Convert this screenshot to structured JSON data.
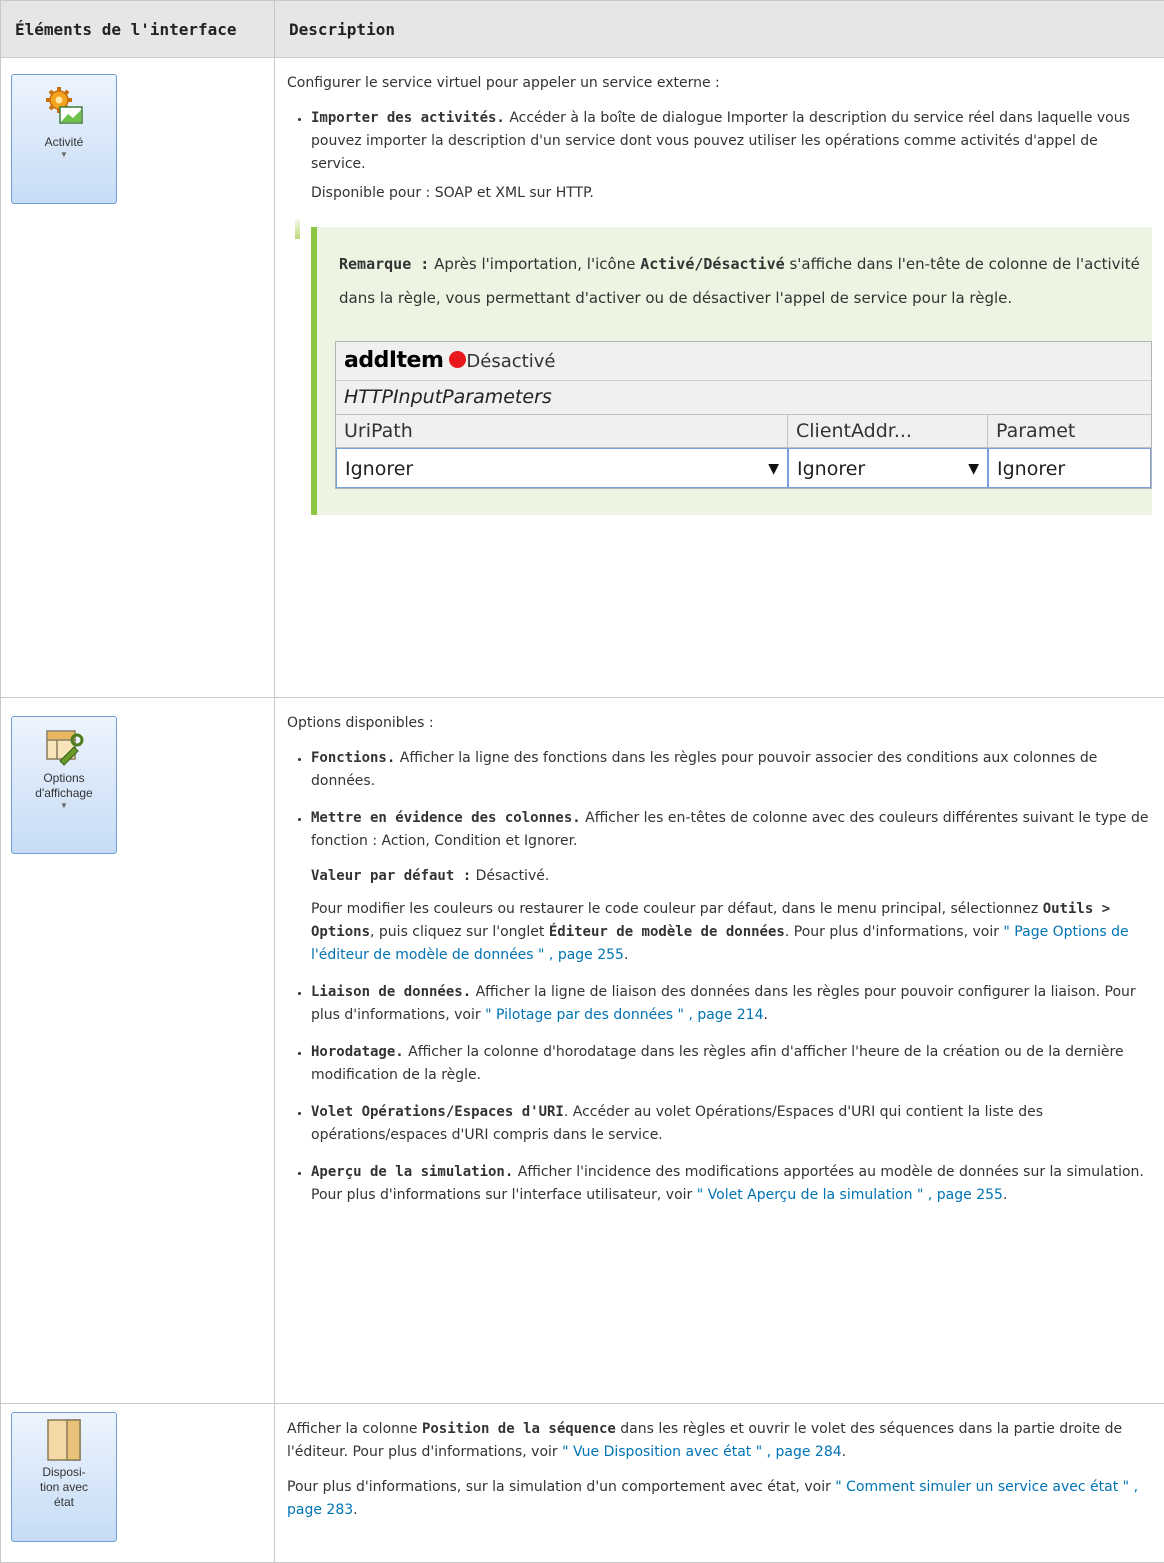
{
  "header": {
    "col1": "Éléments de l'interface",
    "col2": "Description"
  },
  "rows": [
    {
      "button": {
        "label": "Activité",
        "icon": "gear-chart-icon"
      },
      "intro": "Configurer le service virtuel pour appeler un service externe :",
      "items": [
        {
          "title": "Importer des activités.",
          "text": " Accéder à la boîte de dialogue Importer la description du service réel dans laquelle vous pouvez importer la description d'un service dont vous pouvez utiliser les opérations comme activités d'appel de service."
        }
      ],
      "available": "Disponible pour : SOAP et XML sur HTTP.",
      "note": {
        "label": "Remarque :",
        "t1": " Après l'importation, l'icône ",
        "bold": "Activé/Désactivé",
        "t2": " s'affiche dans l'en-tête de colonne de l'activité dans la règle, vous permettant d'activer ou de désactiver l'appel de service pour la règle."
      },
      "screenshot": {
        "activity": "addItem",
        "status": "Désactivé",
        "status_color": "#e8181c",
        "params": "HTTPInputParameters",
        "columns": [
          "UriPath",
          "ClientAddr...",
          "Paramet"
        ],
        "values": [
          "Ignorer",
          "Ignorer",
          "Ignorer"
        ]
      }
    },
    {
      "button": {
        "label1": "Options",
        "label2": "d'affichage",
        "icon": "layout-wrench-icon"
      },
      "intro": "Options disponibles :",
      "items": [
        {
          "title": "Fonctions.",
          "text": " Afficher la ligne des fonctions dans les règles pour pouvoir associer des conditions aux colonnes de données."
        },
        {
          "title": "Mettre en évidence des colonnes.",
          "text": " Afficher les en-têtes de colonne avec des couleurs différentes suivant le type de fonction : Action, Condition et Ignorer."
        },
        {
          "title": "Liaison de données.",
          "text": " Afficher la ligne de liaison des données dans les règles pour pouvoir configurer la liaison. Pour plus d'informations, voir ",
          "link": "\" Pilotage par des données \" , page 214",
          "end": "."
        },
        {
          "title": "Horodatage.",
          "text": " Afficher la colonne d'horodatage dans les règles afin d'afficher l'heure de la création ou de la dernière modification de la règle."
        },
        {
          "title": "Volet Opérations/Espaces d'URI",
          "text": ". Accéder au volet Opérations/Espaces d'URI qui contient la liste des opérations/espaces d'URI compris dans le service."
        },
        {
          "title": "Aperçu de la simulation.",
          "text": " Afficher l'incidence des modifications apportées au modèle de données sur la simulation. Pour plus d'informations sur l'interface utilisateur, voir ",
          "link": "\" Volet Aperçu de la simulation \" , page 255",
          "end": "."
        }
      ],
      "default": {
        "label": "Valeur par défaut :",
        "value": " Désactivé."
      },
      "colors": {
        "t1": "Pour modifier les couleurs ou restaurer le code couleur par défaut, dans le menu principal, sélectionnez ",
        "b1": "Outils > Options",
        "t2": ", puis cliquez sur l'onglet ",
        "b2": "Éditeur de modèle de données",
        "t3": ". Pour plus d'informations, voir ",
        "link": "\" Page Options de l'éditeur de modèle de données \" , page 255",
        "end": "."
      }
    },
    {
      "button": {
        "label1": "Disposi-",
        "label2": "tion avec",
        "label3": "état",
        "icon": "split-panel-icon"
      },
      "p1": {
        "t1": "Afficher la colonne ",
        "b": "Position de la séquence",
        "t2": " dans les règles et ouvrir le volet des séquences dans la partie droite de l'éditeur. Pour plus d'informations, voir ",
        "link": "\" Vue Disposition avec état \" , page 284",
        "end": "."
      },
      "p2": {
        "t1": "Pour plus d'informations, sur la simulation d'un comportement avec état, voir ",
        "link": "\" Comment simuler un service avec état \" , page 283",
        "end": "."
      }
    }
  ]
}
